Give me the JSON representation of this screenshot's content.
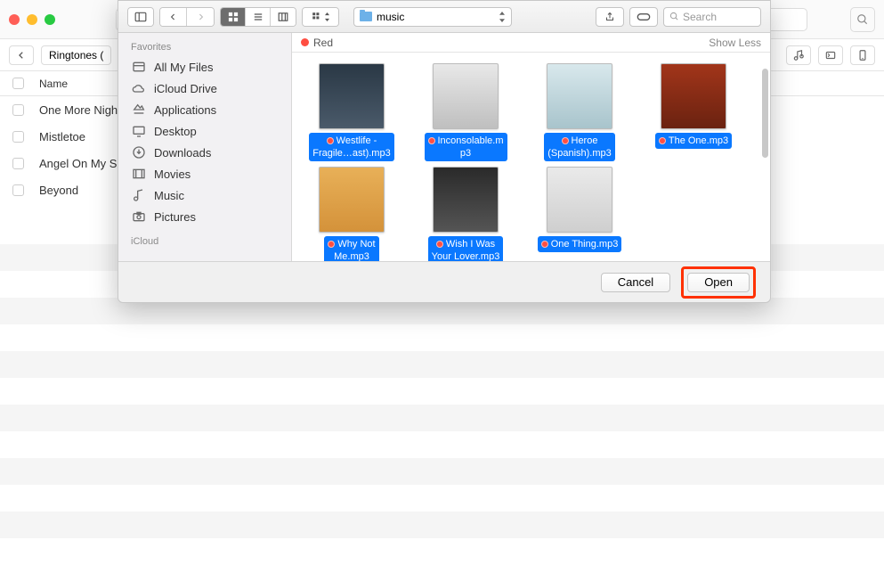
{
  "bg": {
    "breadcrumb": "Ringtones (",
    "header_name": "Name",
    "rows": [
      "One More Nigh",
      "Mistletoe",
      "Angel On My S",
      "Beyond"
    ]
  },
  "dialog": {
    "path_label": "music",
    "search_placeholder": "Search",
    "sidebar": {
      "heads": {
        "favorites": "Favorites",
        "icloud": "iCloud"
      },
      "items": [
        "All My Files",
        "iCloud Drive",
        "Applications",
        "Desktop",
        "Downloads",
        "Movies",
        "Music",
        "Pictures"
      ]
    },
    "tag_label": "Red",
    "show_less": "Show Less",
    "files": [
      {
        "line1": "Westlife -",
        "line2": "Fragile…ast).mp3"
      },
      {
        "line1": "Inconsolable.m",
        "line2": "p3"
      },
      {
        "line1": "Heroe",
        "line2": "(Spanish).mp3"
      },
      {
        "line1": "The One.mp3"
      },
      {
        "line1": "Why Not",
        "line2": "Me.mp3"
      },
      {
        "line1": "Wish I Was",
        "line2": "Your Lover.mp3"
      },
      {
        "line1": "One Thing.mp3"
      }
    ],
    "cancel": "Cancel",
    "open": "Open"
  }
}
